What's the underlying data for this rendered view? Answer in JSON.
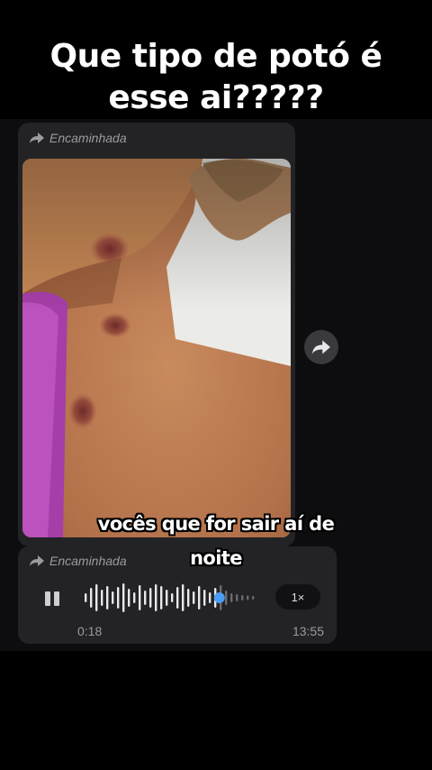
{
  "overlay": {
    "title_line1": "Que tipo de potó é",
    "title_line2": "esse ai?????",
    "subtitle_line1": "vocês que for sair aí de",
    "subtitle_line2": "noite"
  },
  "messages": [
    {
      "forwarded_label": "Encaminhada",
      "type": "image",
      "image_icon": "photo-of-neck-with-bruises"
    },
    {
      "forwarded_label": "Encaminhada",
      "type": "voice",
      "state_icon": "pause-icon",
      "speed": "1×",
      "elapsed": "0:18",
      "sent_time": "13:55",
      "progress": 0.78
    }
  ],
  "colors": {
    "bubble": "#232326",
    "accent": "#4a9cf5",
    "secondary_text": "#9a9aa0"
  }
}
